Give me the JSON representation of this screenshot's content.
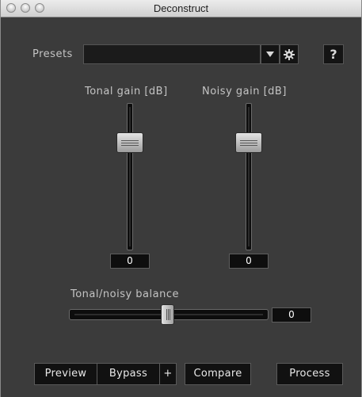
{
  "window": {
    "title": "Deconstruct"
  },
  "presets": {
    "label": "Presets",
    "value": "",
    "dropdown_icon": "triangle-down",
    "settings_icon": "gear",
    "help_label": "?"
  },
  "tonal_gain": {
    "label": "Tonal gain [dB]",
    "value": "0",
    "level": 0.5
  },
  "noisy_gain": {
    "label": "Noisy gain [dB]",
    "value": "0",
    "level": 0.5
  },
  "balance": {
    "label": "Tonal/noisy balance",
    "value": "0",
    "level": 0.5
  },
  "buttons": {
    "preview": "Preview",
    "bypass": "Bypass",
    "plus": "+",
    "compare": "Compare",
    "process": "Process"
  }
}
